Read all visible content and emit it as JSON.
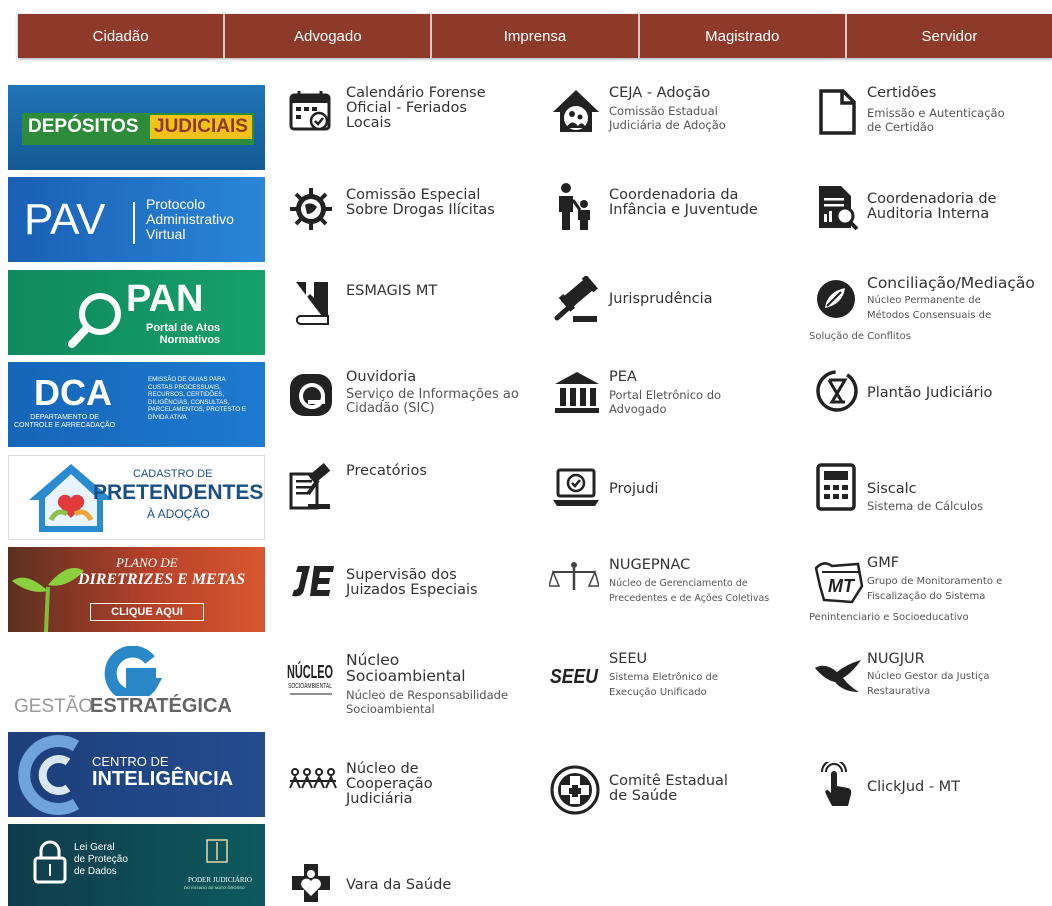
{
  "nav": [
    "Cidadão",
    "Advogado",
    "Imprensa",
    "Magistrado",
    "Servidor"
  ],
  "banners": {
    "depositos": {
      "word1": "DEPÓSITOS",
      "word2": "JUDICIAIS"
    },
    "pav": {
      "abbr": "PAV",
      "desc": "Protocolo\nAdministrativo\nVirtual"
    },
    "pan": {
      "abbr": "PAN",
      "desc": "Portal de Atos\nNormativos"
    },
    "dca": {
      "abbr": "DCA",
      "name": "DEPARTAMENTO DE\nCONTROLE E ARRECADAÇÃO",
      "desc": "EMISSÃO DE GUIAS PARA\nCUSTAS PROCESSUAIS,\nRECURSOS, CERTIDÕES,\nDILIGÊNCIAS, CONSULTAS,\nPARCELAMENTOS, PROTESTO E\nDÍVIDA ATIVA"
    },
    "cadastro": {
      "line1": "CADASTRO DE",
      "line2": "PRETENDENTES",
      "line3": "À ADOÇÃO"
    },
    "plano": {
      "line1": "PLANO DE",
      "line2": "DIRETRIZES E METAS",
      "button": "CLIQUE AQUI"
    },
    "gestao": {
      "word1": "GESTÃO",
      "word2": "ESTRATÉGICA"
    },
    "centro": {
      "line1": "CENTRO DE",
      "line2": "INTELIGÊNCIA"
    },
    "lgpd": {
      "text": "Lei Geral\nde Proteção\nde Dados",
      "org": "PODER JUDICIÁRIO",
      "org_sub": "DO ESTADO DE MATO GROSSO"
    }
  },
  "links": [
    {
      "icon": "calendar-icon",
      "title": "Calendário Forense\nOficial - Feriados\nLocais",
      "subtitle": ""
    },
    {
      "icon": "adoption-house-icon",
      "title": "CEJA - Adoção",
      "subtitle": "Comissão Estadual\nJudiciária de Adoção"
    },
    {
      "icon": "document-icon",
      "title": "Certidões",
      "subtitle": "Emissão e Autenticação\nde Certidão"
    },
    {
      "icon": "globe-gear-icon",
      "title": "Comissão Especial\nSobre Drogas Ilícitas",
      "subtitle": ""
    },
    {
      "icon": "parent-child-icon",
      "title": "Coordenadoria da\nInfância e Juventude",
      "subtitle": ""
    },
    {
      "icon": "report-search-icon",
      "title": "Coordenadoria de\nAuditoria Interna",
      "subtitle": ""
    },
    {
      "icon": "book-icon",
      "title": "ESMAGIS MT",
      "subtitle": ""
    },
    {
      "icon": "gavel-icon",
      "title": "Jurisprudência",
      "subtitle": ""
    },
    {
      "icon": "leaf-circle-icon",
      "title": "Conciliação/Mediação",
      "subtitle": "Núcleo Permanente de\nMétodos Consensuais de\nSolução de Conflitos"
    },
    {
      "icon": "at-sign-icon",
      "title": "Ouvidoria",
      "subtitle": "Serviço de Informações ao\nCidadão (SIC)"
    },
    {
      "icon": "courthouse-icon",
      "title": "PEA",
      "subtitle": "Portal Eletrônico do\nAdvogado"
    },
    {
      "icon": "hourglass-clock-icon",
      "title": "Plantão Judiciário",
      "subtitle": ""
    },
    {
      "icon": "document-gavel-icon",
      "title": "Precatórios",
      "subtitle": ""
    },
    {
      "icon": "laptop-check-icon",
      "title": "Projudi",
      "subtitle": ""
    },
    {
      "icon": "calculator-icon",
      "title": "Siscalc",
      "subtitle": "Sistema de Cálculos"
    },
    {
      "icon": "je-logo-icon",
      "title": "Supervisão dos\nJuizados Especiais",
      "subtitle": ""
    },
    {
      "icon": "scales-icon",
      "title": "NUGEPNAC",
      "subtitle": "Núcleo de Gerenciamento de\nPrecedentes e de Ações Coletivas"
    },
    {
      "icon": "mt-map-icon",
      "title": "GMF",
      "subtitle": "Grupo de Monitoramento e\nFiscalização do Sistema\nPenintenciario e Socioeducativo"
    },
    {
      "icon": "nucleo-logo-icon",
      "title": "Núcleo\nSocioambiental",
      "subtitle": "Núcleo de Responsabilidade\nSocioambiental"
    },
    {
      "icon": "seeu-logo-icon",
      "title": "SEEU",
      "subtitle": "Sistema Eletrônico de\nExecução Unificado"
    },
    {
      "icon": "bird-icon",
      "title": "NUGJUR",
      "subtitle": "Núcleo Gestor da Justiça\nRestaurativa"
    },
    {
      "icon": "people-chain-icon",
      "title": "Núcleo de\nCooperação\nJudiciária",
      "subtitle": ""
    },
    {
      "icon": "health-cross-icon",
      "title": "Comitê Estadual\nde Saúde",
      "subtitle": ""
    },
    {
      "icon": "touch-hand-icon",
      "title": "ClickJud - MT",
      "subtitle": ""
    },
    {
      "icon": "medical-heart-icon",
      "title": "Vara da Saúde",
      "subtitle": ""
    }
  ],
  "lgpd_org_label": "PODER JUDICIÁRIO"
}
